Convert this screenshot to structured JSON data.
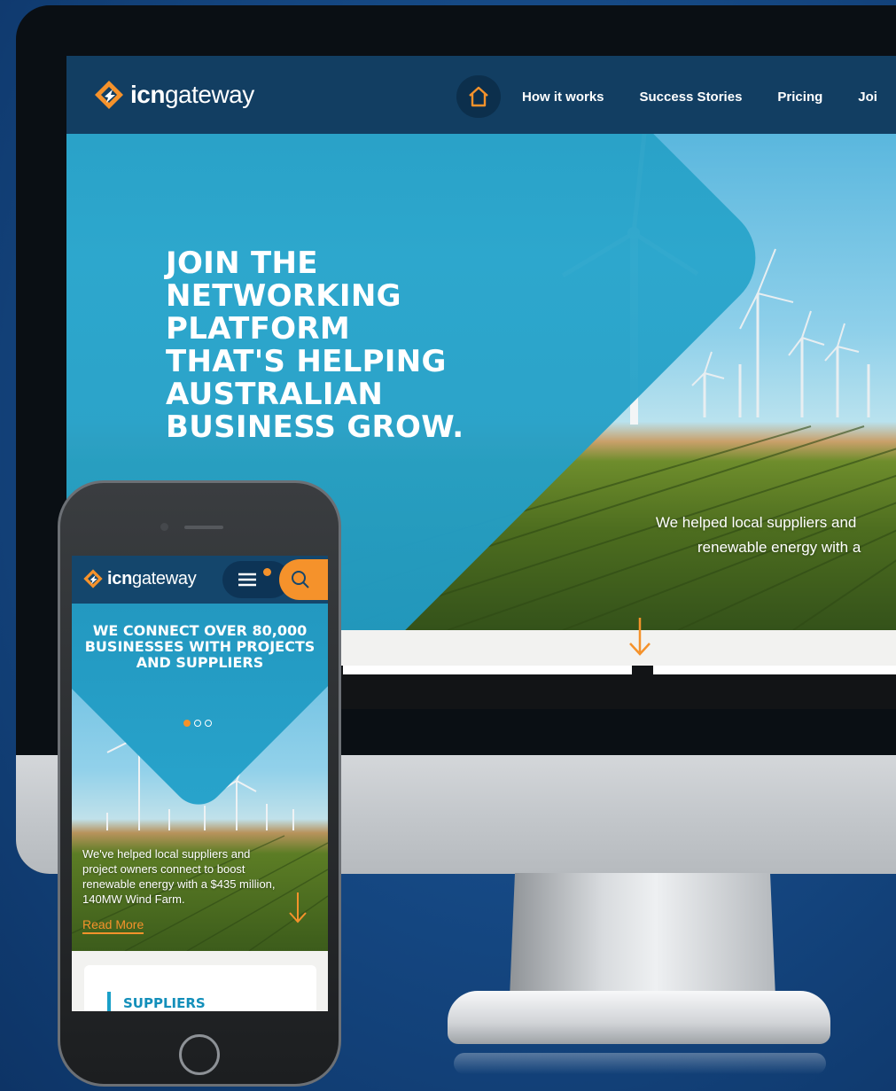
{
  "desktop": {
    "logo": {
      "bold": "icn",
      "regular": "gateway"
    },
    "nav": {
      "items": [
        {
          "label": "How it works"
        },
        {
          "label": "Success Stories"
        },
        {
          "label": "Pricing"
        },
        {
          "label": "Joi"
        }
      ]
    },
    "hero": {
      "headline": "JOIN THE NETWORKING PLATFORM THAT'S HELPING AUSTRALIAN BUSINESS GROW.",
      "caption_line1": "We helped local suppliers and",
      "caption_line2": "renewable energy with a"
    }
  },
  "mobile": {
    "logo": {
      "bold": "icn",
      "regular": "gateway"
    },
    "hero": {
      "headline": "WE CONNECT OVER 80,000 BUSINESSES WITH PROJECTS AND SUPPLIERS",
      "caption": "We've helped local suppliers and project owners connect to boost renewable energy with a $435 million, 140MW Wind Farm.",
      "read_more": "Read More"
    },
    "card": {
      "title": "SUPPLIERS"
    }
  },
  "colors": {
    "header": "#123e62",
    "accent_orange": "#f5922b",
    "teal": "#1f90b8",
    "background": "#164a86"
  },
  "icons": [
    "home-icon",
    "hamburger-menu-icon",
    "search-icon",
    "arrow-down-icon",
    "icn-logo-icon"
  ]
}
